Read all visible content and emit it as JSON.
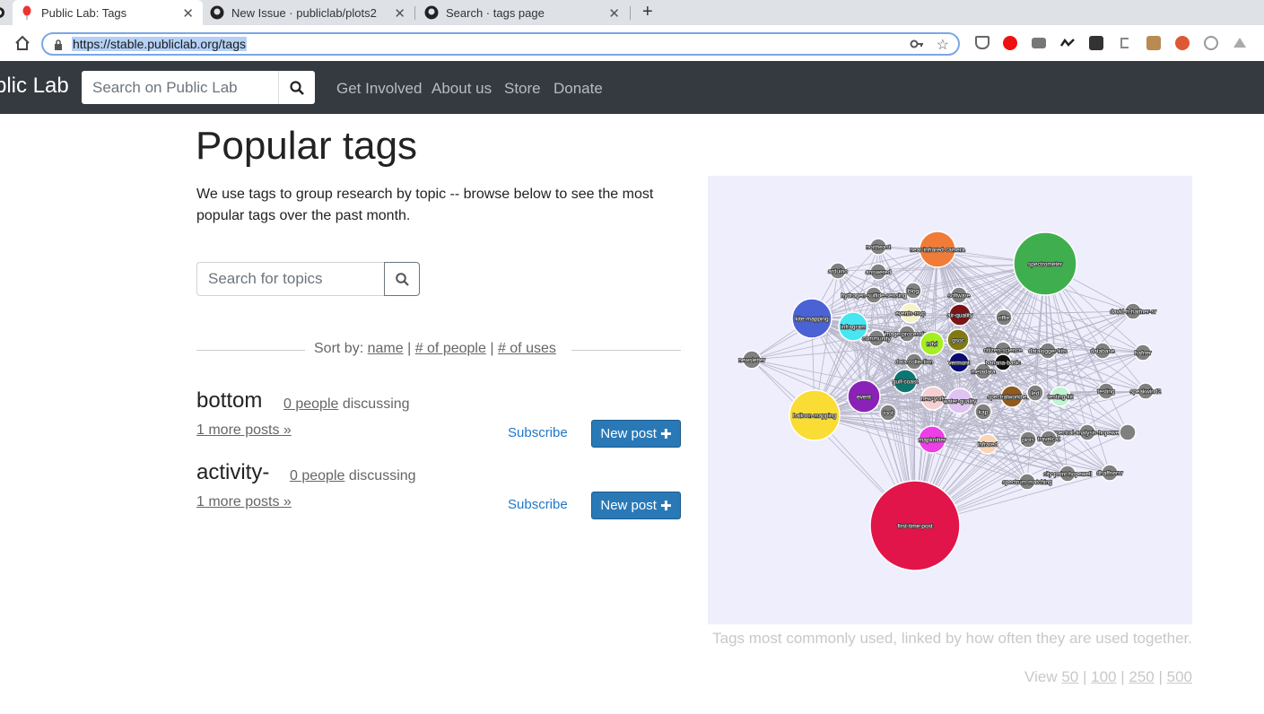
{
  "browser": {
    "tabs": [
      {
        "title": "Public Lab: Tags"
      },
      {
        "title": "New Issue · publiclab/plots2"
      },
      {
        "title": "Search · tags page"
      }
    ],
    "url": "https://stable.publiclab.org/tags"
  },
  "navbar": {
    "brand": "blic Lab",
    "search_placeholder": "Search on Public Lab",
    "links": [
      "Get Involved",
      "About us",
      "Store",
      "Donate"
    ]
  },
  "page": {
    "title": "Popular tags",
    "intro": "We use tags to group research by topic -- browse below to see the most popular tags over the past month.",
    "topic_search_placeholder": "Search for topics",
    "sort": {
      "prefix": "Sort by:",
      "name": "name",
      "people": "# of people",
      "uses": "# of uses",
      "sep": "|"
    }
  },
  "tags": [
    {
      "name": "bottom",
      "people": "0 people",
      "discussing": "discussing",
      "more": "1 more posts",
      "subscribe": "Subscribe",
      "new_post": "New post"
    },
    {
      "name": "activity-",
      "people": "0 people",
      "discussing": "discussing",
      "more": "1 more posts",
      "subscribe": "Subscribe",
      "new_post": "New post"
    }
  ],
  "graph": {
    "caption": "Tags most commonly used, linked by how often they are used together.",
    "view_prefix": "View",
    "view_options": [
      "50",
      "100",
      "250",
      "500"
    ],
    "node_labels": {
      "spectrometer": "spectrometer",
      "first_time_post": "first-time-post",
      "near_infrared": "near-infrared-camera",
      "balloon": "balloon-mapping",
      "kite": "kite-mapping",
      "infragram": "infragram",
      "event": "event",
      "mapknitter": "mapknitter",
      "northeast": "northeast",
      "arduino": "arduino",
      "answered": "answered",
      "blog": "blog",
      "hydrogen": "hydrogen-sulfide-sensing",
      "software": "software",
      "events": "events-rsvp",
      "air_quality": "air-quality",
      "riffle": "riffle",
      "david": "david-h-hatfner-sr",
      "image_processing": "image-processing",
      "community": "community",
      "ndvi": "ndvi",
      "gsoc": "gsoc",
      "citizen_science": "citizen-science",
      "datalogger": "datalogger-kits",
      "database": "database",
      "hafner": "hafner",
      "newsletter": "newsletter",
      "data_collection": "data-collection",
      "vermont": "vermont",
      "metadata": "metadata",
      "banana": "banana-basic",
      "gulf_coast": "gulf-coast",
      "new_york": "new-york",
      "water_quality": "water-quality",
      "spectral_workbench": "spectralworkbench",
      "led": "led",
      "testing_kit": "testing-kit",
      "testing": "testing",
      "speakwind": "speakwind2",
      "tool": "tool",
      "kap": "kap",
      "spectral_analysis": "spectral-analysis-hopewell",
      "infrared": "infrared",
      "plots": "plots",
      "traveler": "travelcat",
      "city_point": "city-point-hopewell",
      "dhaffner": "dhaffnersr",
      "spectrum": "spectrum-matching"
    }
  },
  "colors": {
    "navbar": "#343a40",
    "link_blue": "#1f78c8",
    "button_blue": "#2a79b7",
    "graph_bg": "#eeeefc",
    "node_gray": "#808080"
  }
}
